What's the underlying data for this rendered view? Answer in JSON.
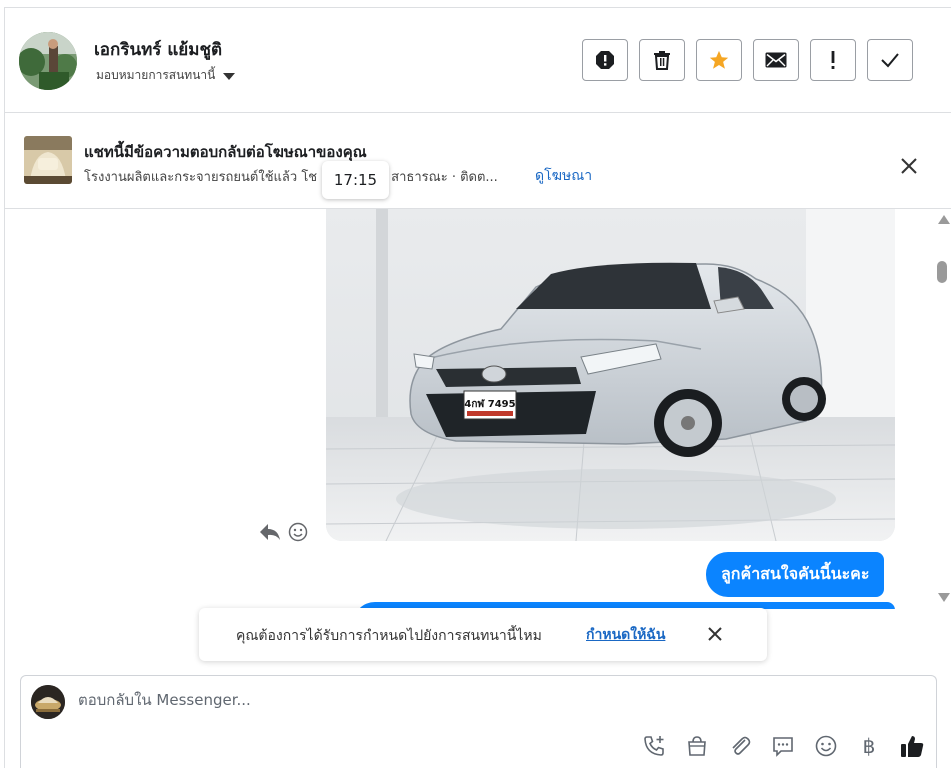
{
  "header": {
    "contact_name": "เอกรินทร์ แย้มชูติ",
    "assign_label": "มอบหมายการสนทนานี้",
    "toolbar": [
      {
        "name": "spam-button",
        "icon": "octagon-alert-icon"
      },
      {
        "name": "delete-button",
        "icon": "trash-icon"
      },
      {
        "name": "star-button",
        "icon": "star-icon",
        "color": "#f5a623"
      },
      {
        "name": "mark-unread-button",
        "icon": "envelope-icon"
      },
      {
        "name": "follow-up-button",
        "icon": "exclamation-icon"
      },
      {
        "name": "mark-done-button",
        "icon": "checkmark-icon"
      }
    ]
  },
  "ad_banner": {
    "title": "แชทนี้มีข้อความตอบกลับต่อโฆษณาของคุณ",
    "description": "โรงงานผลิตและกระจายรถยนต์ใช้แล้ว โช",
    "description_tail": "ชร์กับ สาธารณะ · ติดต...",
    "link_label": "ดูโฆษณา",
    "timestamp": "17:15"
  },
  "messages": {
    "outgoing_text": "ลูกค้าสนใจคันนี้นะคะ",
    "bubble_color": "#0b84ff",
    "plate": "4กฬ 7495"
  },
  "toast": {
    "text": "คุณต้องการได้รับการกำหนดไปยังการสนทนานี้ไหม",
    "link_label": "กำหนดให้ฉัน"
  },
  "composer": {
    "placeholder": "ตอบกลับใน Messenger...",
    "currency_symbol": "฿",
    "tools": [
      "phone-add-icon",
      "shopping-bag-icon",
      "paperclip-icon",
      "saved-reply-icon",
      "emoji-icon",
      "baht-icon",
      "thumbs-up-icon"
    ]
  }
}
